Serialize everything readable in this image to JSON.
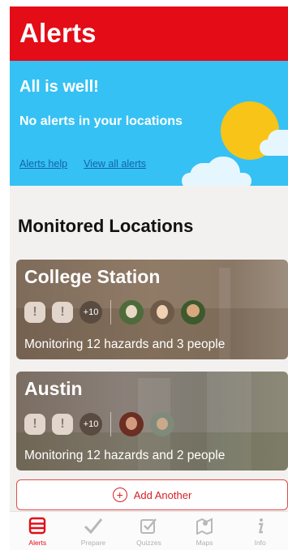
{
  "header": {
    "title": "Alerts"
  },
  "banner": {
    "title": "All is well!",
    "subtitle": "No alerts in your locations",
    "links": [
      {
        "label": "Alerts help"
      },
      {
        "label": "View all alerts"
      }
    ]
  },
  "section": {
    "title": "Monitored Locations"
  },
  "locations": [
    {
      "name": "College Station",
      "hazard_count_badge": "+10",
      "status": "Monitoring 12 hazards and 3 people"
    },
    {
      "name": "Austin",
      "hazard_count_badge": "+10",
      "status": "Monitoring 12 hazards and 2 people"
    }
  ],
  "add_button": {
    "label": "Add Another"
  },
  "tabs": [
    {
      "label": "Alerts",
      "icon": "alerts-icon",
      "active": true
    },
    {
      "label": "Prepare",
      "icon": "checkmark-icon",
      "active": false
    },
    {
      "label": "Quizzes",
      "icon": "quiz-icon",
      "active": false
    },
    {
      "label": "Maps",
      "icon": "map-icon",
      "active": false
    },
    {
      "label": "Info",
      "icon": "info-icon",
      "active": false
    }
  ],
  "colors": {
    "brand_red": "#e30c17",
    "banner_blue": "#35c1f4",
    "sun_yellow": "#f8c417",
    "tab_inactive": "#b0b0b0"
  }
}
